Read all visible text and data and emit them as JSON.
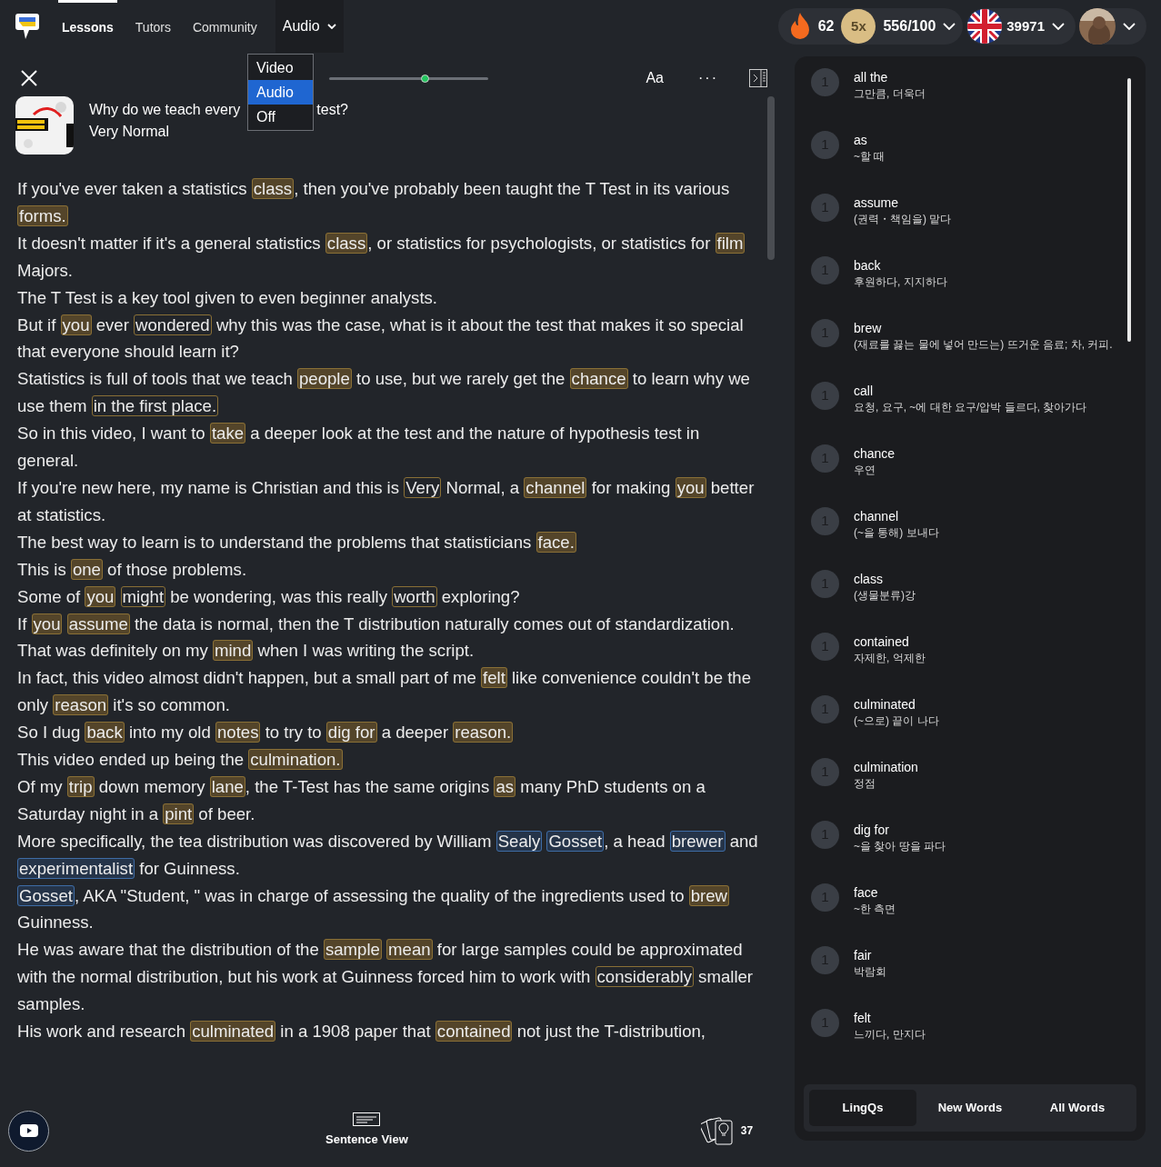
{
  "nav": {
    "items": [
      {
        "label": "Lessons",
        "selected": true
      },
      {
        "label": "Tutors",
        "selected": false
      },
      {
        "label": "Community",
        "selected": false
      }
    ],
    "media_mode": {
      "label": "Audio",
      "expanded": true,
      "options": [
        {
          "label": "Video",
          "selected": false
        },
        {
          "label": "Audio",
          "selected": true
        },
        {
          "label": "Off",
          "selected": false
        }
      ]
    }
  },
  "stats": {
    "streak": "62",
    "multiplier": "5x",
    "progress": "556/100",
    "known_words": "39971"
  },
  "player": {
    "level": 0.6,
    "font_button": "Aa",
    "more_button": "···"
  },
  "lesson": {
    "title_parts": [
      "Why do we teach every",
      "test?"
    ],
    "course": "Very Normal"
  },
  "transcript": [
    [
      {
        "kind": "plain",
        "text": "If you've ever taken a statistics "
      },
      {
        "kind": "lingq",
        "text": "class"
      },
      {
        "kind": "plain",
        "text": ", then you've probably been taught the T Test in its various "
      },
      {
        "kind": "lingq",
        "text": "forms."
      }
    ],
    [
      {
        "kind": "plain",
        "text": "It doesn't matter if it's a general statistics "
      },
      {
        "kind": "lingq",
        "text": "class"
      },
      {
        "kind": "plain",
        "text": ", or statistics for psychologists, or statistics for "
      },
      {
        "kind": "lingq",
        "text": "film"
      },
      {
        "kind": "plain",
        "text": " Majors."
      }
    ],
    [
      {
        "kind": "plain",
        "text": "The T Test is a key tool given to even beginner analysts."
      }
    ],
    [
      {
        "kind": "plain",
        "text": "But if "
      },
      {
        "kind": "lingq",
        "text": "you"
      },
      {
        "kind": "plain",
        "text": " ever "
      },
      {
        "kind": "phrase",
        "text": "wondered"
      },
      {
        "kind": "plain",
        "text": " why this was the case, what is it about the test that makes it so special that everyone should learn it?"
      }
    ],
    [
      {
        "kind": "plain",
        "text": "Statistics is full of tools that we teach "
      },
      {
        "kind": "lingq",
        "text": "people"
      },
      {
        "kind": "plain",
        "text": " to use, but we rarely get the "
      },
      {
        "kind": "lingq",
        "text": "chance"
      },
      {
        "kind": "plain",
        "text": " to learn why we use them "
      },
      {
        "kind": "phrase",
        "text": "in the first place."
      }
    ],
    [
      {
        "kind": "plain",
        "text": "So in this video, I want to "
      },
      {
        "kind": "lingq",
        "text": "take"
      },
      {
        "kind": "plain",
        "text": " a deeper look at the test and the nature of hypothesis test in general."
      }
    ],
    [
      {
        "kind": "plain",
        "text": "If you're new here, my name is Christian and this is "
      },
      {
        "kind": "phrase",
        "text": "Very"
      },
      {
        "kind": "plain",
        "text": " Normal, a "
      },
      {
        "kind": "lingq",
        "text": "channel"
      },
      {
        "kind": "plain",
        "text": " for making "
      },
      {
        "kind": "lingq",
        "text": "you"
      },
      {
        "kind": "plain",
        "text": " better at statistics."
      }
    ],
    [
      {
        "kind": "plain",
        "text": "The best way to learn is to understand the problems that statisticians "
      },
      {
        "kind": "lingq",
        "text": "face."
      }
    ],
    [
      {
        "kind": "plain",
        "text": "This is "
      },
      {
        "kind": "lingq",
        "text": "one"
      },
      {
        "kind": "plain",
        "text": " of those problems."
      }
    ],
    [
      {
        "kind": "plain",
        "text": "Some of "
      },
      {
        "kind": "lingq",
        "text": "you"
      },
      {
        "kind": "phrase",
        "text": "might"
      },
      {
        "kind": "plain",
        "text": " be wondering, was this really "
      },
      {
        "kind": "phrase",
        "text": "worth"
      },
      {
        "kind": "plain",
        "text": " exploring?"
      }
    ],
    [
      {
        "kind": "plain",
        "text": "If "
      },
      {
        "kind": "lingq",
        "text": "you"
      },
      {
        "kind": "lingq",
        "text": "assume"
      },
      {
        "kind": "plain",
        "text": " the data is normal, then the T distribution naturally comes out of standardization."
      }
    ],
    [
      {
        "kind": "plain",
        "text": "That was definitely on my "
      },
      {
        "kind": "lingq",
        "text": "mind"
      },
      {
        "kind": "plain",
        "text": " when I was writing the script."
      }
    ],
    [
      {
        "kind": "plain",
        "text": "In fact, this video almost didn't happen, but a small part of me "
      },
      {
        "kind": "lingq",
        "text": "felt"
      },
      {
        "kind": "plain",
        "text": " like convenience couldn't be the only "
      },
      {
        "kind": "lingq",
        "text": "reason"
      },
      {
        "kind": "plain",
        "text": " it's so common."
      }
    ],
    [
      {
        "kind": "plain",
        "text": "So I dug "
      },
      {
        "kind": "lingq",
        "text": "back"
      },
      {
        "kind": "plain",
        "text": " into my old "
      },
      {
        "kind": "lingq",
        "text": "notes"
      },
      {
        "kind": "plain",
        "text": " to try to "
      },
      {
        "kind": "lingq",
        "text": "dig for"
      },
      {
        "kind": "plain",
        "text": " a deeper "
      },
      {
        "kind": "lingq",
        "text": "reason."
      }
    ],
    [
      {
        "kind": "plain",
        "text": "This video ended up being the "
      },
      {
        "kind": "lingq",
        "text": "culmination."
      }
    ],
    [
      {
        "kind": "plain",
        "text": "Of my "
      },
      {
        "kind": "lingq",
        "text": "trip"
      },
      {
        "kind": "plain",
        "text": " down memory "
      },
      {
        "kind": "lingq",
        "text": "lane"
      },
      {
        "kind": "plain",
        "text": ", the T-Test has the same origins "
      },
      {
        "kind": "lingq",
        "text": "as"
      },
      {
        "kind": "plain",
        "text": " many PhD students on a Saturday night in a "
      },
      {
        "kind": "lingq",
        "text": "pint"
      },
      {
        "kind": "plain",
        "text": " of beer."
      }
    ],
    [
      {
        "kind": "plain",
        "text": "More specifically, the tea distribution was discovered by William "
      },
      {
        "kind": "new",
        "text": "Sealy"
      },
      {
        "kind": "new",
        "text": "Gosset"
      },
      {
        "kind": "plain",
        "text": ", a head "
      },
      {
        "kind": "new",
        "text": "brewer"
      },
      {
        "kind": "plain",
        "text": " and "
      },
      {
        "kind": "new",
        "text": "experimentalist"
      },
      {
        "kind": "plain",
        "text": " for Guinness."
      }
    ],
    [
      {
        "kind": "new",
        "text": "Gosset"
      },
      {
        "kind": "plain",
        "text": ", AKA \"Student, \" was in charge of assessing the quality of the ingredients used to "
      },
      {
        "kind": "lingq",
        "text": "brew"
      },
      {
        "kind": "plain",
        "text": " Guinness."
      }
    ],
    [
      {
        "kind": "plain",
        "text": "He was aware that the distribution of the "
      },
      {
        "kind": "lingq",
        "text": "sample"
      },
      {
        "kind": "lingq",
        "text": "mean"
      },
      {
        "kind": "plain",
        "text": " for large samples could be approximated with the normal distribution, but his work at Guinness forced him to work with "
      },
      {
        "kind": "phrase",
        "text": "considerably"
      },
      {
        "kind": "plain",
        "text": " smaller samples."
      }
    ],
    [
      {
        "kind": "plain",
        "text": "His work and research "
      },
      {
        "kind": "lingq",
        "text": "culminated"
      },
      {
        "kind": "plain",
        "text": " in a 1908 paper that "
      },
      {
        "kind": "lingq",
        "text": "contained"
      },
      {
        "kind": "plain",
        "text": " not just the T-distribution,"
      }
    ]
  ],
  "vocabulary": [
    {
      "status": "1",
      "term": "all the",
      "meaning": "그만큼, 더욱더"
    },
    {
      "status": "1",
      "term": "as",
      "meaning": "~할 때"
    },
    {
      "status": "1",
      "term": "assume",
      "meaning": "(권력・책임을) 맡다"
    },
    {
      "status": "1",
      "term": "back",
      "meaning": "후원하다, 지지하다"
    },
    {
      "status": "1",
      "term": "brew",
      "meaning": "(재료를 끓는 물에 넣어 만드는) 뜨거운 음료; 차, 커피."
    },
    {
      "status": "1",
      "term": "call",
      "meaning": "요청, 요구, ~에 대한 요구/압박 들르다, 찾아가다"
    },
    {
      "status": "1",
      "term": "chance",
      "meaning": "우연"
    },
    {
      "status": "1",
      "term": "channel",
      "meaning": "(~을 통해) 보내다"
    },
    {
      "status": "1",
      "term": "class",
      "meaning": "(생물분류)강"
    },
    {
      "status": "1",
      "term": "contained",
      "meaning": "자제한, 억제한"
    },
    {
      "status": "1",
      "term": "culminated",
      "meaning": "(~으로) 끝이 나다"
    },
    {
      "status": "1",
      "term": "culmination",
      "meaning": "정점"
    },
    {
      "status": "1",
      "term": "dig for",
      "meaning": "~을 찾아 땅을 파다"
    },
    {
      "status": "1",
      "term": "face",
      "meaning": "~한 측면"
    },
    {
      "status": "1",
      "term": "fair",
      "meaning": "박람회"
    },
    {
      "status": "1",
      "term": "felt",
      "meaning": "느끼다, 만지다"
    }
  ],
  "vocab_tabs": [
    {
      "label": "LingQs",
      "selected": true
    },
    {
      "label": "New Words",
      "selected": false
    },
    {
      "label": "All Words",
      "selected": false
    }
  ],
  "footer": {
    "sentence_view": "Sentence View",
    "cards_count": "37"
  }
}
